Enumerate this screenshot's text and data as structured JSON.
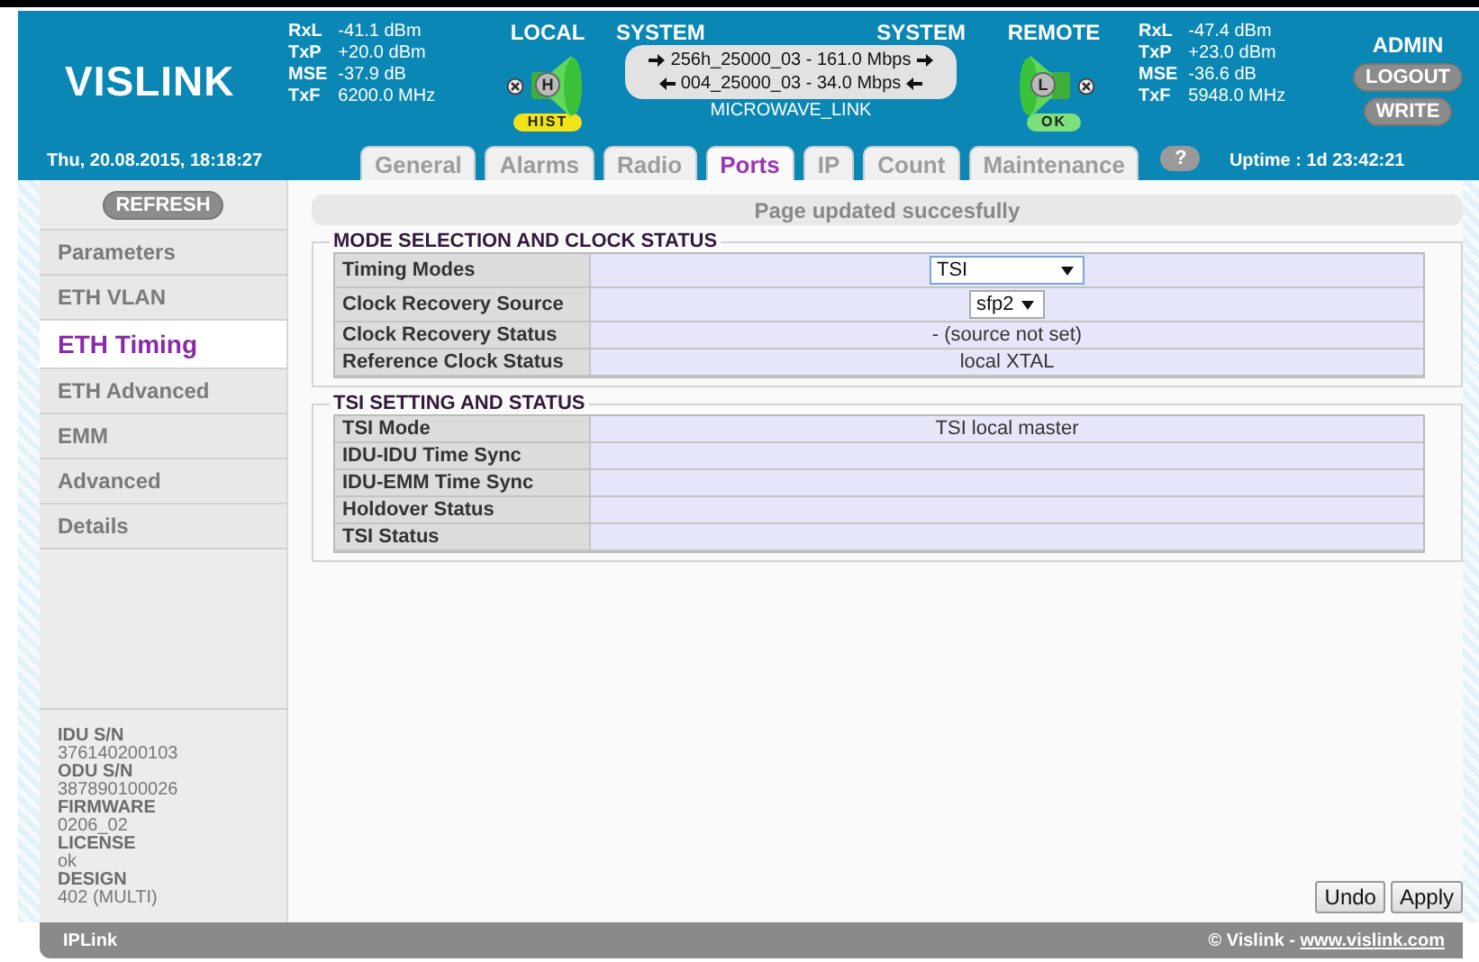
{
  "header": {
    "logo": "VISLINK",
    "local_stats": [
      {
        "label": "RxL",
        "value": "-41.1 dBm"
      },
      {
        "label": "TxP",
        "value": "+20.0 dBm"
      },
      {
        "label": "MSE",
        "value": "-37.9 dB"
      },
      {
        "label": "TxF",
        "value": "6200.0 MHz"
      }
    ],
    "local": {
      "title": "LOCAL",
      "letter": "H",
      "badge": "HIST",
      "color": "#f2e21a"
    },
    "system": {
      "title_left": "SYSTEM",
      "title_right": "SYSTEM",
      "links": [
        {
          "kind": "forward",
          "text": "256h_25000_03 - 161.0 Mbps"
        },
        {
          "kind": "back",
          "text": "004_25000_03 - 34.0 Mbps"
        }
      ],
      "name": "MICROWAVE_LINK"
    },
    "remote": {
      "title": "REMOTE",
      "letter": "L",
      "badge": "OK",
      "color": "#7ee07a"
    },
    "remote_stats": [
      {
        "label": "RxL",
        "value": "-47.4 dBm"
      },
      {
        "label": "TxP",
        "value": "+23.0 dBm"
      },
      {
        "label": "MSE",
        "value": "-36.6 dB"
      },
      {
        "label": "TxF",
        "value": "5948.0 MHz"
      }
    ],
    "user": {
      "name": "ADMIN",
      "buttons": [
        "LOGOUT",
        "WRITE"
      ]
    },
    "date": "Thu, 20.08.2015, 18:18:27",
    "tabs": [
      {
        "label": "General",
        "selected": false
      },
      {
        "label": "Alarms",
        "selected": false
      },
      {
        "label": "Radio",
        "selected": false
      },
      {
        "label": "Ports",
        "selected": true
      },
      {
        "label": "IP",
        "selected": false
      },
      {
        "label": "Count",
        "selected": false
      },
      {
        "label": "Maintenance",
        "selected": false
      }
    ],
    "help": "?",
    "uptime": "Uptime : 1d 23:42:21"
  },
  "sidebar": {
    "refresh": "REFRESH",
    "items": [
      {
        "label": "Parameters",
        "selected": false
      },
      {
        "label": "ETH VLAN",
        "selected": false
      },
      {
        "label": "ETH Timing",
        "selected": true
      },
      {
        "label": "ETH Advanced",
        "selected": false
      },
      {
        "label": "EMM",
        "selected": false
      },
      {
        "label": "Advanced",
        "selected": false
      },
      {
        "label": "Details",
        "selected": false
      }
    ],
    "info": [
      {
        "label": "IDU S/N",
        "value": "376140200103"
      },
      {
        "label": "ODU S/N",
        "value": "387890100026"
      },
      {
        "label": "FIRMWARE",
        "value": "0206_02"
      },
      {
        "label": "LICENSE",
        "value": "ok"
      },
      {
        "label": "DESIGN",
        "value": "402 (MULTI)"
      }
    ]
  },
  "content": {
    "status": "Page updated succesfully",
    "sections": [
      {
        "title": "MODE SELECTION AND CLOCK STATUS",
        "rows": [
          {
            "label": "Timing Modes",
            "kind": "select",
            "value": "TSI",
            "wide": true
          },
          {
            "label": "Clock Recovery Source",
            "kind": "select",
            "value": "sfp2",
            "wide": false
          },
          {
            "label": "Clock Recovery Status",
            "kind": "text",
            "value": "- (source not set)"
          },
          {
            "label": "Reference Clock Status",
            "kind": "text",
            "value": "local XTAL"
          }
        ]
      },
      {
        "title": "TSI SETTING AND STATUS",
        "rows": [
          {
            "label": "TSI Mode",
            "kind": "text",
            "value": "TSI local master"
          },
          {
            "label": "IDU-IDU Time Sync",
            "kind": "text"
          },
          {
            "label": "IDU-EMM Time Sync",
            "kind": "text"
          },
          {
            "label": "Holdover Status",
            "kind": "text"
          },
          {
            "label": "TSI Status",
            "kind": "text"
          }
        ]
      }
    ],
    "buttons": [
      "Undo",
      "Apply"
    ]
  },
  "footer": {
    "left": "IPLink",
    "copyright": "© Vislink - ",
    "link": "www.vislink.com"
  }
}
